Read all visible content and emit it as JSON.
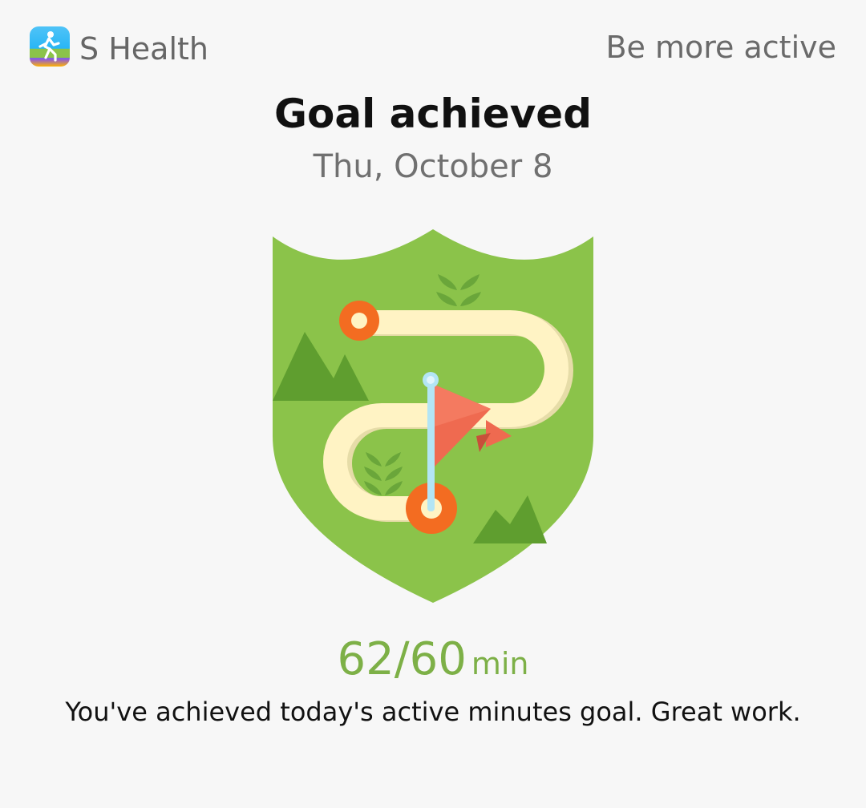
{
  "header": {
    "app_icon": "runner-icon",
    "app_name": "S Health",
    "program_name": "Be more active"
  },
  "main": {
    "title": "Goal achieved",
    "date": "Thu, October 8",
    "badge_icon": "trail-flag-shield-icon",
    "score_value": "62/60",
    "score_unit": "min",
    "message": "You've achieved today's active minutes goal. Great work."
  },
  "colors": {
    "accent": "#7db047",
    "shield": "#8bc34a",
    "trail": "#fff3c4",
    "marker": "#f36c21",
    "flag": "#ef6a50"
  }
}
